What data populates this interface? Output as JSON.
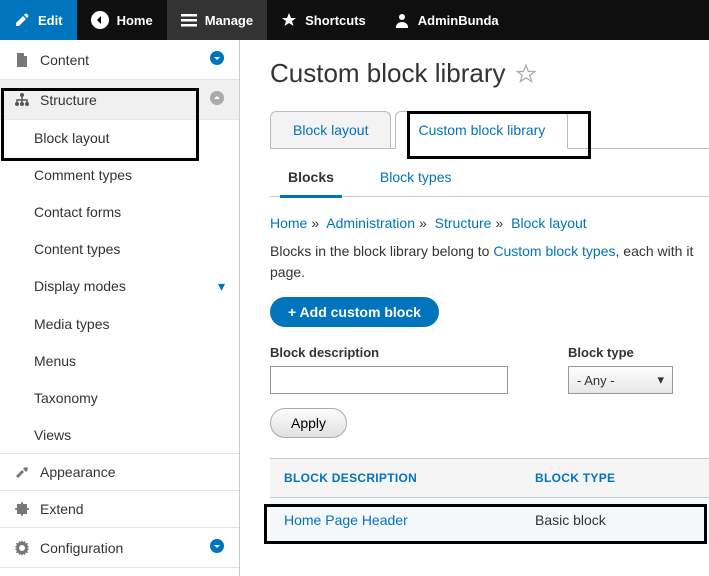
{
  "topbar": {
    "edit": "Edit",
    "home": "Home",
    "manage": "Manage",
    "shortcuts": "Shortcuts",
    "user": "AdminBunda"
  },
  "sidebar": {
    "content": "Content",
    "structure": "Structure",
    "structure_items": [
      "Block layout",
      "Comment types",
      "Contact forms",
      "Content types",
      "Display modes",
      "Media types",
      "Menus",
      "Taxonomy",
      "Views"
    ],
    "appearance": "Appearance",
    "extend": "Extend",
    "configuration": "Configuration"
  },
  "page": {
    "title": "Custom block library",
    "tabs_primary": [
      "Block layout",
      "Custom block library"
    ],
    "tabs_secondary": [
      "Blocks",
      "Block types"
    ],
    "breadcrumb": [
      "Home",
      "Administration",
      "Structure",
      "Block layout"
    ],
    "description_pre": "Blocks in the block library belong to ",
    "description_link": "Custom block types",
    "description_post": ", each with its own fields and display settings. After creating a block, place it in a region from the ",
    "description_link2_short": "page.",
    "add_button": "+ Add custom block",
    "filter_desc_label": "Block description",
    "filter_type_label": "Block type",
    "filter_type_value": "- Any -",
    "apply": "Apply",
    "table_headers": [
      "BLOCK DESCRIPTION",
      "BLOCK TYPE"
    ],
    "table_rows": [
      {
        "name": "Home Page Header",
        "type": "Basic block"
      }
    ]
  }
}
